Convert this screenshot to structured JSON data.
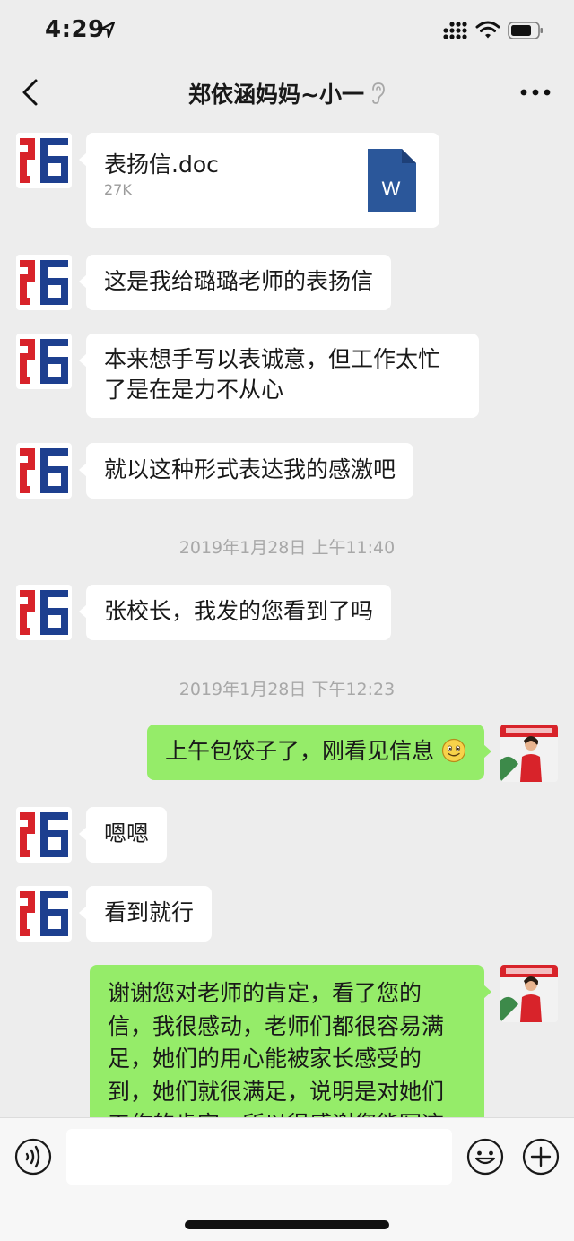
{
  "status_bar": {
    "time": "4:29"
  },
  "nav": {
    "title": "郑依涵妈妈~小一"
  },
  "messages": [
    {
      "file_name": "表扬信.doc",
      "file_size": "27K",
      "file_icon_letter": "W"
    },
    {
      "text": "这是我给璐璐老师的表扬信"
    },
    {
      "line1": "本来想手写以表诚意，但工作太忙",
      "line2": "了是在是力不从心"
    },
    {
      "text": "就以这种形式表达我的感激吧"
    },
    {
      "timestamp": "2019年1月28日 上午11:40"
    },
    {
      "text": "张校长，我发的您看到了吗"
    },
    {
      "timestamp": "2019年1月28日 下午12:23"
    },
    {
      "text": "上午包饺子了，刚看见信息"
    },
    {
      "text": "嗯嗯"
    },
    {
      "text": "看到就行"
    },
    {
      "line1": "谢谢您对老师的肯定，看了您的",
      "line2": "信，我很感动，老师们都很容易满",
      "line3": "足，她们的用心能被家长感受的",
      "line4": "到，她们就很满足，说明是对她们",
      "line5": "工作的肯定，所以很感谢您能写这"
    }
  ],
  "colors": {
    "accent_green": "#95ec69",
    "logo_red": "#d8232a",
    "logo_blue": "#1d3f8f",
    "word_blue": "#2b579a"
  }
}
